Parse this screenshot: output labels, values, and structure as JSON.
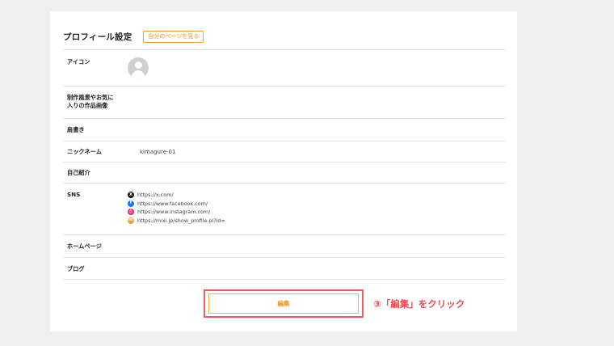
{
  "header": {
    "title": "プロフィール設定",
    "view_page_label": "自分のページを見る"
  },
  "profile": {
    "icon_label": "アイコン",
    "works_label_line1": "制作風景やお気に",
    "works_label_line2": "入りの作品画像",
    "title_label": "肩書き",
    "nickname_label": "ニックネーム",
    "nickname_value": "kimagure-01",
    "bio_label": "自己紹介",
    "sns_label": "SNS",
    "homepage_label": "ホームページ",
    "blog_label": "ブログ"
  },
  "sns": [
    {
      "icon": "x-icon",
      "color": "#111111",
      "glyph": "X",
      "url": "https://x.com/"
    },
    {
      "icon": "facebook-icon",
      "color": "#1877f2",
      "glyph": "f",
      "url": "https://www.facebook.com/"
    },
    {
      "icon": "instagram-icon",
      "color": "#e1306c",
      "glyph": "◎",
      "url": "https://www.instagram.com/"
    },
    {
      "icon": "mixi-icon",
      "color": "#e8a33a",
      "glyph": "m",
      "url": "https://mixi.jp/show_profile.pl?id="
    }
  ],
  "edit_button_label": "編集",
  "annotation_text": "③「編集」をクリック",
  "colors": {
    "accent": "#f0962a",
    "highlight": "#ef5a63",
    "background": "#efefef"
  }
}
